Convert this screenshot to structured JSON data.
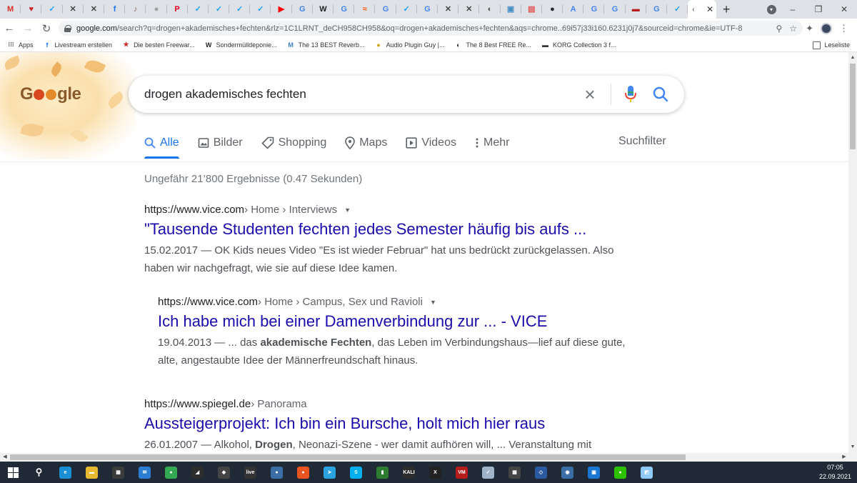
{
  "browser": {
    "tabs": [
      {
        "icon": "gmail-icon",
        "glyph": "M",
        "color": "#d93025"
      },
      {
        "icon": "shield-icon",
        "glyph": "♥",
        "color": "#c62828"
      },
      {
        "icon": "twitter-icon",
        "glyph": "✓",
        "color": "#1da1f2"
      },
      {
        "icon": "close-circle-icon",
        "glyph": "✕",
        "color": "#444444"
      },
      {
        "icon": "close-circle-icon",
        "glyph": "✕",
        "color": "#444444"
      },
      {
        "icon": "facebook-icon",
        "glyph": "f",
        "color": "#1877f2"
      },
      {
        "icon": "bookmark-icon",
        "glyph": "♪",
        "color": "#8d6e63"
      },
      {
        "icon": "blob-icon",
        "glyph": "●",
        "color": "#9e9e9e"
      },
      {
        "icon": "pinterest-icon",
        "glyph": "P",
        "color": "#e60023"
      },
      {
        "icon": "twitter-icon",
        "glyph": "✓",
        "color": "#1da1f2"
      },
      {
        "icon": "twitter-icon",
        "glyph": "✓",
        "color": "#1da1f2"
      },
      {
        "icon": "twitter-icon",
        "glyph": "✓",
        "color": "#1da1f2"
      },
      {
        "icon": "twitter-icon",
        "glyph": "✓",
        "color": "#1da1f2"
      },
      {
        "icon": "youtube-icon",
        "glyph": "▶",
        "color": "#ff0000"
      },
      {
        "icon": "google-icon",
        "glyph": "G",
        "color": "#4285f4"
      },
      {
        "icon": "wikipedia-icon",
        "glyph": "W",
        "color": "#222222"
      },
      {
        "icon": "google-icon",
        "glyph": "G",
        "color": "#4285f4"
      },
      {
        "icon": "soundcloud-icon",
        "glyph": "≈",
        "color": "#ff5500"
      },
      {
        "icon": "google-icon",
        "glyph": "G",
        "color": "#4285f4"
      },
      {
        "icon": "twitter-icon",
        "glyph": "✓",
        "color": "#1da1f2"
      },
      {
        "icon": "google-icon",
        "glyph": "G",
        "color": "#4285f4"
      },
      {
        "icon": "close-circle-icon",
        "glyph": "✕",
        "color": "#444444"
      },
      {
        "icon": "close-circle-icon",
        "glyph": "✕",
        "color": "#444444"
      },
      {
        "icon": "globe-icon",
        "glyph": "◐",
        "color": "#555555"
      },
      {
        "icon": "picture-icon",
        "glyph": "▣",
        "color": "#4a90c2"
      },
      {
        "icon": "gradient-icon",
        "glyph": "▤",
        "color": "#e25555"
      },
      {
        "icon": "github-icon",
        "glyph": "●",
        "color": "#24292e"
      },
      {
        "icon": "translate-icon",
        "glyph": "A",
        "color": "#4285f4"
      },
      {
        "icon": "google-icon",
        "glyph": "G",
        "color": "#4285f4"
      },
      {
        "icon": "google-icon",
        "glyph": "G",
        "color": "#4285f4"
      },
      {
        "icon": "car-icon",
        "glyph": "▬",
        "color": "#b71c1c"
      },
      {
        "icon": "google-icon",
        "glyph": "G",
        "color": "#4285f4"
      },
      {
        "icon": "twitter-icon",
        "glyph": "✓",
        "color": "#1da1f2"
      }
    ],
    "active_tab": {
      "title": "‹",
      "close": "✕"
    },
    "new_tab": "+",
    "window_controls": {
      "minimize": "–",
      "maximize": "❐",
      "close": "✕"
    },
    "nav": {
      "back": "←",
      "forward": "→",
      "reload": "↻"
    },
    "url_host": "google.com",
    "url_rest": "/search?q=drogen+akademisches+fechten&rlz=1C1LRNT_deCH958CH958&oq=drogen+akademisches+fechten&aqs=chrome..69i57j33i160.6231j0j7&sourceid=chrome&ie=UTF-8",
    "omnibox_icons": {
      "zoom": "⚲",
      "star": "☆"
    },
    "extensions_icon": "✦",
    "menu_icon": "⋮",
    "bookmarks": [
      {
        "label": "Apps",
        "icon": "apps-grid-icon",
        "glyph": "⁝⁝⁝",
        "color": "#5f6368"
      },
      {
        "label": "Livestream erstellen",
        "icon": "facebook-icon",
        "glyph": "f",
        "color": "#1877f2"
      },
      {
        "label": "Die besten Freewar...",
        "icon": "star-icon",
        "glyph": "★",
        "color": "#c62828"
      },
      {
        "label": "Sondermülldeponie...",
        "icon": "wikipedia-icon",
        "glyph": "W",
        "color": "#222222"
      },
      {
        "label": "The 13 BEST Reverb...",
        "icon": "m-logo-icon",
        "glyph": "M",
        "color": "#3d7fc2"
      },
      {
        "label": "Audio Plugin Guy |...",
        "icon": "plugin-guy-icon",
        "glyph": "●",
        "color": "#d4a017"
      },
      {
        "label": "The 8 Best FREE Re...",
        "icon": "dark-drop-icon",
        "glyph": "◐",
        "color": "#222222"
      },
      {
        "label": "KORG Collection 3 f...",
        "icon": "korg-icon",
        "glyph": "▬",
        "color": "#333333"
      }
    ],
    "reading_list": "Leseliste"
  },
  "search": {
    "doodle_text": "Google",
    "query": "drogen akademisches fechten",
    "tabs": [
      {
        "label": "Alle",
        "icon": "search-icon",
        "active": true
      },
      {
        "label": "Bilder",
        "icon": "image-icon",
        "active": false
      },
      {
        "label": "Shopping",
        "icon": "tag-icon",
        "active": false
      },
      {
        "label": "Maps",
        "icon": "map-pin-icon",
        "active": false
      },
      {
        "label": "Videos",
        "icon": "play-icon",
        "active": false
      },
      {
        "label": "Mehr",
        "icon": "more-vert-icon",
        "active": false
      }
    ],
    "filter_label": "Suchfilter",
    "stats": "Ungefähr 21’800 Ergebnisse (0.47 Sekunden)",
    "results": [
      {
        "cite": "https://www.vice.com",
        "crumbs": " › Home › Interviews",
        "has_menu": true,
        "title": "\"Tausende Studenten fechten jedes Semester häufig bis aufs ...",
        "snippet": [
          {
            "t": "15.02.2017 — OK Kids neues Video \"Es ist wieder Februar\" hat uns bedrückt zurückgelassen. Also haben wir nachgefragt, wie sie auf diese Idee kamen.",
            "b": false
          }
        ]
      },
      {
        "cite": "https://www.vice.com",
        "crumbs": " › Home › Campus, Sex und Ravioli",
        "has_menu": true,
        "title": "Ich habe mich bei einer Damenverbindung zur ... - VICE",
        "snippet": [
          {
            "t": "19.04.2013 — ... das ",
            "b": false
          },
          {
            "t": "akademische Fechten",
            "b": true
          },
          {
            "t": ", das Leben im Verbindungshaus—lief auf diese gute, alte, angestaubte Idee der Männerfreundschaft hinaus.",
            "b": false
          }
        ]
      },
      {
        "cite": "https://www.spiegel.de",
        "crumbs": " › Panorama",
        "has_menu": false,
        "title": "Aussteigerprojekt: Ich bin ein Bursche, holt mich hier raus",
        "snippet": [
          {
            "t": "26.01.2007 — Alkohol, ",
            "b": false
          },
          {
            "t": "Drogen",
            "b": true
          },
          {
            "t": ", Neonazi-Szene - wer damit aufhören will, ... Veranstaltung mit",
            "b": false
          }
        ]
      }
    ]
  },
  "taskbar": {
    "items": [
      {
        "icon": "search-icon",
        "glyph": "⚲",
        "color": "transparent"
      },
      {
        "icon": "edge-icon",
        "glyph": "e",
        "color": "#1b8fd4"
      },
      {
        "icon": "file-explorer-icon",
        "glyph": "▬",
        "color": "#e8b930"
      },
      {
        "icon": "store-icon",
        "glyph": "▦",
        "color": "#3c3c3c"
      },
      {
        "icon": "mail-icon",
        "glyph": "✉",
        "color": "#2b7cd3"
      },
      {
        "icon": "chrome-icon",
        "glyph": "●",
        "color": "#34a853"
      },
      {
        "icon": "app-icon",
        "glyph": "◢",
        "color": "#2d2d2d"
      },
      {
        "icon": "inkscape-icon",
        "glyph": "◆",
        "color": "#444444"
      },
      {
        "icon": "live-icon",
        "glyph": "live",
        "color": "#333333"
      },
      {
        "icon": "blue-app-icon",
        "glyph": "●",
        "color": "#3a6ea5"
      },
      {
        "icon": "ubuntu-icon",
        "glyph": "●",
        "color": "#e95420"
      },
      {
        "icon": "telegram-icon",
        "glyph": "➤",
        "color": "#2aa3df"
      },
      {
        "icon": "skype-icon",
        "glyph": "S",
        "color": "#00aff0"
      },
      {
        "icon": "app-icon",
        "glyph": "▮",
        "color": "#2e7d32"
      },
      {
        "icon": "kali-icon",
        "glyph": "KALI",
        "color": "#2d2d2d"
      },
      {
        "icon": "app-icon",
        "glyph": "X",
        "color": "#222222"
      },
      {
        "icon": "voicemeeter-icon",
        "glyph": "VM",
        "color": "#b71c1c"
      },
      {
        "icon": "app-icon",
        "glyph": "✓",
        "color": "#9fb4c8"
      },
      {
        "icon": "app-icon",
        "glyph": "▦",
        "color": "#444444"
      },
      {
        "icon": "virtualbox-icon",
        "glyph": "◇",
        "color": "#2c5aa0"
      },
      {
        "icon": "app-icon",
        "glyph": "◉",
        "color": "#3a6ea5"
      },
      {
        "icon": "app-icon",
        "glyph": "▣",
        "color": "#1976d2"
      },
      {
        "icon": "wechat-icon",
        "glyph": "●",
        "color": "#2dc100"
      },
      {
        "icon": "app-icon",
        "glyph": "◩",
        "color": "#90caf9"
      }
    ],
    "clock": {
      "time": "07:05",
      "date": "22.09.2021"
    }
  }
}
